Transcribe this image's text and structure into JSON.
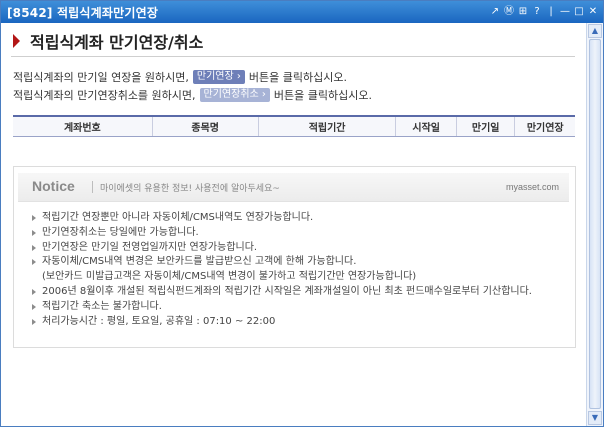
{
  "window": {
    "title": "[8542] 적립식계좌만기연장"
  },
  "title_controls": [
    "↗",
    "Ⓜ",
    "⊞",
    "?",
    "|",
    "—",
    "□",
    "✕"
  ],
  "page": {
    "title": "적립식계좌 만기연장/취소"
  },
  "desc": {
    "line1_pre": "적립식계좌의 만기일 연장을 원하시면,",
    "line1_btn": "만기연장 ›",
    "line1_post": "버튼을 클릭하십시오.",
    "line2_pre": "적립식계좌의 만기연장취소를 원하시면,",
    "line2_btn": "만기연장취소 ›",
    "line2_post": "버튼을 클릭하십시오."
  },
  "table": {
    "headers": [
      "계좌번호",
      "종목명",
      "적립기간",
      "시작일",
      "만기일",
      "만기연장"
    ]
  },
  "notice": {
    "title": "Notice",
    "subtitle": "마이에셋의 유용한 정보! 사용전에 알아두세요~",
    "brand": "myasset.com",
    "items": [
      {
        "text": "적립기간 연장뿐만 아니라 자동이체/CMS내역도 연장가능합니다.",
        "cont": false
      },
      {
        "text": "만기연장취소는 당일에만 가능합니다.",
        "cont": false
      },
      {
        "text": "만기연장은 만기일 전영업일까지만 연장가능합니다.",
        "cont": false
      },
      {
        "text": "자동이체/CMS내역 변경은 보안카드를 발급받으신 고객에 한해 가능합니다.",
        "cont": false
      },
      {
        "text": "(보안카드 미발급고객은 자동이체/CMS내역 변경이 불가하고 적립기간만 연장가능합니다)",
        "cont": true
      },
      {
        "text": "2006년 8월이후 개설된 적립식펀드계좌의 적립기간 시작일은 계좌개설일이 아닌 최초 펀드매수일로부터 기산합니다.",
        "cont": false
      },
      {
        "text": "적립기간 축소는 불가합니다.",
        "cont": false
      },
      {
        "text": "처리가능시간 : 평일, 토요일, 공휴일 : 07:10 ~ 22:00",
        "cont": false
      }
    ]
  },
  "colors": {
    "titlebar": "#1a66c0",
    "accent": "#b31717",
    "pill": "#6e7fb8",
    "table_rule": "#5a6aa8"
  }
}
